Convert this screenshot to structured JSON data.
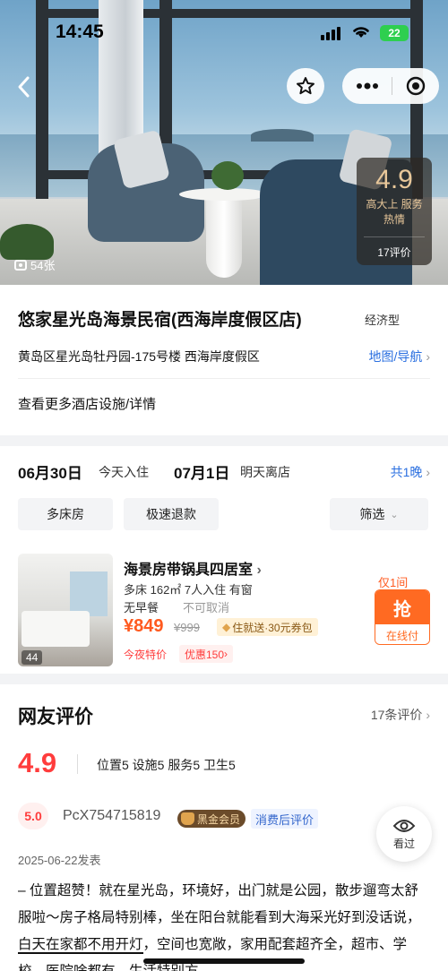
{
  "status_bar": {
    "time": "14:45",
    "battery": "22"
  },
  "hero": {
    "rating": "4.9",
    "rating_tags": "高大上 服务热情",
    "review_count": "17评价",
    "photo_count": "54张"
  },
  "hotel": {
    "name": "悠家星光岛海景民宿(西海岸度假区店)",
    "type": "经济型",
    "address": "黄岛区星光岛牡丹园-175号楼  西海岸度假区",
    "map_link": "地图/导航",
    "more_facilities": "查看更多酒店设施/详情"
  },
  "booking": {
    "checkin_date": "06月30日",
    "checkin_label": "今天入住",
    "checkout_date": "07月1日",
    "checkout_label": "明天离店",
    "nights": "共1晚",
    "filters": [
      "多床房",
      "极速退款",
      "筛选"
    ],
    "room": {
      "name": "海景房带锅具四居室",
      "spec": "多床 162㎡ 7人入住 有窗",
      "meal": "无早餐",
      "cancel": "不可取消",
      "price": "¥849",
      "original_price": "¥999",
      "promo": "住就送·30元券包",
      "deal_1": "今夜特价",
      "deal_2": "优惠150",
      "image_count": "44",
      "only_left": "仅1间",
      "grab_label": "抢",
      "pay_label": "在线付"
    }
  },
  "reviews": {
    "title": "网友评价",
    "count": "17条评价",
    "score": "4.9",
    "sub_scores": "位置5  设施5  服务5  卫生5",
    "item": {
      "score": "5.0",
      "user": "PcX754715819",
      "badge": "黑金会员",
      "tag": "消费后评价",
      "date": "2025-06-22发表",
      "body_1": "– 位置超赞！就在星光岛，环境好，出门就是公园，散步遛弯太舒服啦～房子格局特别棒，坐在阳台就能看到大海采光好到没话说，",
      "body_highlight": "白天在家都不用开灯",
      "body_2": "，空间也宽敞，家用配套超齐全，超市、学校、医院啥都有，生活特别方"
    }
  },
  "float": {
    "seen_label": "看过"
  }
}
